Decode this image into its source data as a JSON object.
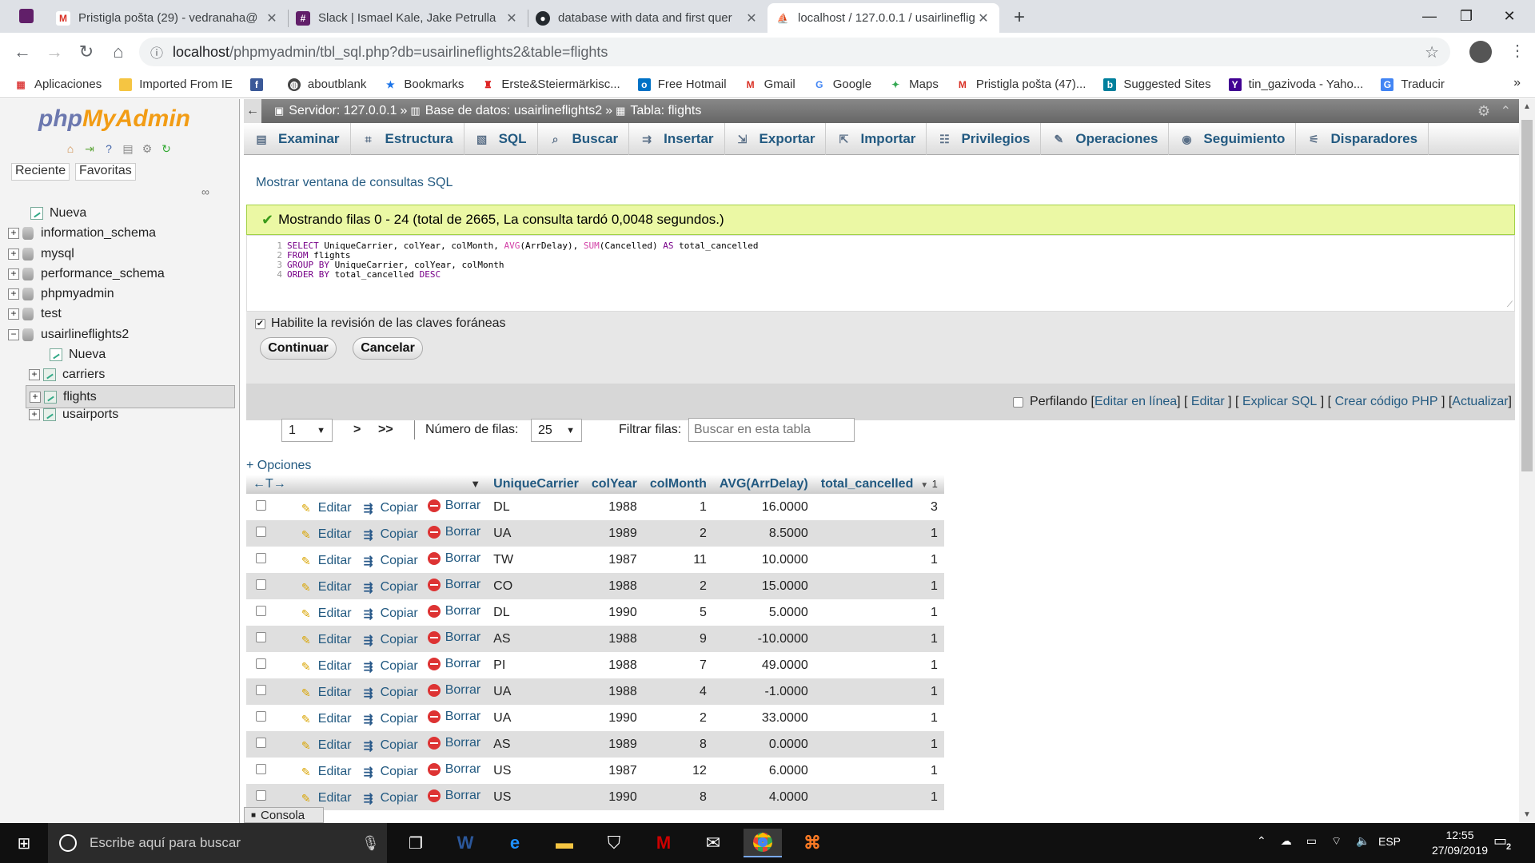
{
  "browser": {
    "tabs": [
      {
        "title": "Pristigla pošta (29) - vedranaha@",
        "favicon": "gmail-icon"
      },
      {
        "title": "Slack | Ismael Kale, Jake Petrulla",
        "favicon": "slack-icon"
      },
      {
        "title": "database with data and first quer",
        "favicon": "github-icon"
      },
      {
        "title": "localhost / 127.0.0.1 / usairlineflig",
        "favicon": "phpmyadmin-icon"
      }
    ],
    "url_host": "localhost",
    "url_path": "/phpmyadmin/tbl_sql.php?db=usairlineflights2&table=flights",
    "bookmarks": [
      "Aplicaciones",
      "Imported From IE",
      "",
      "aboutblank",
      "Bookmarks",
      "Erste&Steiermärkisc...",
      "Free Hotmail",
      "Gmail",
      "Google",
      "Maps",
      "Pristigla pošta (47)...",
      "Suggested Sites",
      "tin_gazivoda - Yaho...",
      "Traducir"
    ],
    "more": "»"
  },
  "sidebar": {
    "logo_php": "php",
    "logo_myadmin": "MyAdmin",
    "recent": "Reciente",
    "favorites": "Favoritas",
    "tree": [
      {
        "label": "Nueva",
        "kind": "new",
        "level": 0
      },
      {
        "label": "information_schema",
        "kind": "db",
        "level": 0
      },
      {
        "label": "mysql",
        "kind": "db",
        "level": 0
      },
      {
        "label": "performance_schema",
        "kind": "db",
        "level": 0
      },
      {
        "label": "phpmyadmin",
        "kind": "db",
        "level": 0
      },
      {
        "label": "test",
        "kind": "db",
        "level": 0
      },
      {
        "label": "usairlineflights2",
        "kind": "db-open",
        "level": 0
      },
      {
        "label": "Nueva",
        "kind": "new",
        "level": 1
      },
      {
        "label": "carriers",
        "kind": "table",
        "level": 1
      },
      {
        "label": "flights",
        "kind": "table",
        "level": 1
      },
      {
        "label": "usairports",
        "kind": "table",
        "level": 1
      }
    ]
  },
  "breadcrumb": {
    "server": "Servidor: 127.0.0.1",
    "database": "Base de datos: usairlineflights2",
    "table": "Tabla: flights",
    "sep": "»"
  },
  "menu": [
    "Examinar",
    "Estructura",
    "SQL",
    "Buscar",
    "Insertar",
    "Exportar",
    "Importar",
    "Privilegios",
    "Operaciones",
    "Seguimiento",
    "Disparadores"
  ],
  "show_sql_window": "Mostrar ventana de consultas SQL",
  "success_message": "Mostrando filas 0 - 24 (total de 2665, La consulta tardó 0,0048 segundos.)",
  "sql_lines": [
    {
      "n": "1",
      "parts": [
        [
          "kw",
          "SELECT"
        ],
        [
          "t",
          " UniqueCarrier, colYear, colMonth, "
        ],
        [
          "fn",
          "AVG"
        ],
        [
          "t",
          "(ArrDelay), "
        ],
        [
          "fn",
          "SUM"
        ],
        [
          "t",
          "(Cancelled) "
        ],
        [
          "kw",
          "AS"
        ],
        [
          "t",
          " total_cancelled"
        ]
      ]
    },
    {
      "n": "2",
      "parts": [
        [
          "kw",
          "FROM"
        ],
        [
          "t",
          " flights"
        ]
      ]
    },
    {
      "n": "3",
      "parts": [
        [
          "kw",
          "GROUP BY"
        ],
        [
          "t",
          " UniqueCarrier, colYear, colMonth"
        ]
      ]
    },
    {
      "n": "4",
      "parts": [
        [
          "kw",
          "ORDER BY"
        ],
        [
          "t",
          " total_cancelled "
        ],
        [
          "kw",
          "DESC"
        ]
      ]
    }
  ],
  "fk_check_label": "Habilite la revisión de las claves foráneas",
  "continue_label": "Continuar",
  "cancel_label": "Cancelar",
  "profiling": {
    "label": "Perfilando",
    "links": [
      "Editar en línea",
      "Editar",
      "Explicar SQL",
      "Crear código PHP",
      "Actualizar"
    ]
  },
  "pager": {
    "page": "1",
    "next": ">",
    "last": ">>",
    "rows_label": "Número de filas:",
    "rows_value": "25",
    "filter_label": "Filtrar filas:",
    "filter_placeholder": "Buscar en esta tabla"
  },
  "options_label": "+ Opciones",
  "table": {
    "arrows": "←T→",
    "columns": [
      "UniqueCarrier",
      "colYear",
      "colMonth",
      "AVG(ArrDelay)",
      "total_cancelled"
    ],
    "sort_index": "1",
    "action_labels": {
      "edit": "Editar",
      "copy": "Copiar",
      "delete": "Borrar"
    },
    "rows": [
      [
        "DL",
        "1988",
        "1",
        "16.0000",
        "3"
      ],
      [
        "UA",
        "1989",
        "2",
        "8.5000",
        "1"
      ],
      [
        "TW",
        "1987",
        "11",
        "10.0000",
        "1"
      ],
      [
        "CO",
        "1988",
        "2",
        "15.0000",
        "1"
      ],
      [
        "DL",
        "1990",
        "5",
        "5.0000",
        "1"
      ],
      [
        "AS",
        "1988",
        "9",
        "-10.0000",
        "1"
      ],
      [
        "PI",
        "1988",
        "7",
        "49.0000",
        "1"
      ],
      [
        "UA",
        "1988",
        "4",
        "-1.0000",
        "1"
      ],
      [
        "UA",
        "1990",
        "2",
        "33.0000",
        "1"
      ],
      [
        "AS",
        "1989",
        "8",
        "0.0000",
        "1"
      ],
      [
        "US",
        "1987",
        "12",
        "6.0000",
        "1"
      ],
      [
        "US",
        "1990",
        "8",
        "4.0000",
        "1"
      ]
    ]
  },
  "console_label": "Consola",
  "taskbar": {
    "search_placeholder": "Escribe aquí para buscar",
    "lang": "ESP",
    "time": "12:55",
    "date": "27/09/2019",
    "notifications": "2"
  },
  "colors": {
    "link": "#235a81",
    "success_bg": "#ebf8a4",
    "logo_php": "#6c78af",
    "logo_myadmin": "#f29c14"
  }
}
